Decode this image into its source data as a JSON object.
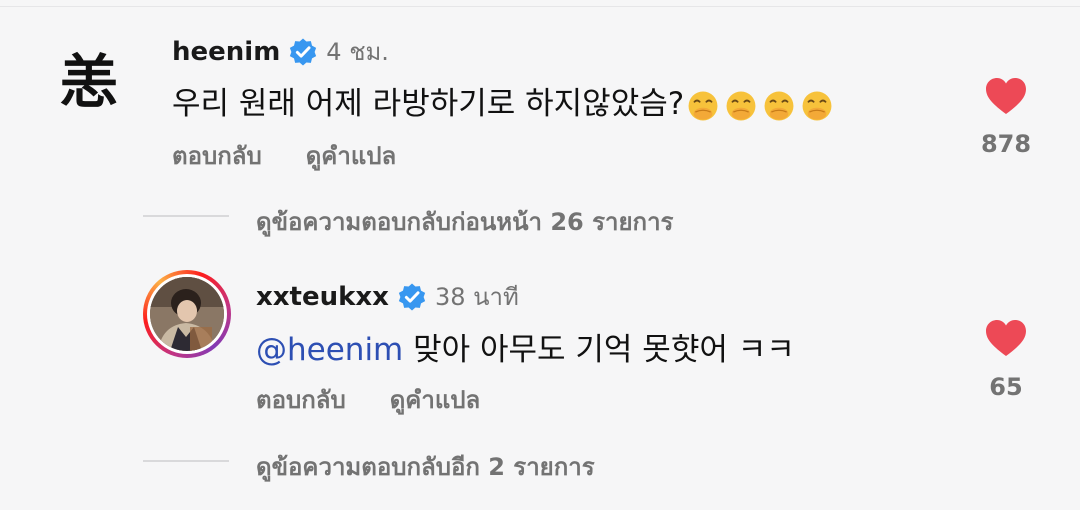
{
  "comment": {
    "username": "heenim",
    "verified": true,
    "timestamp": "4 ชม.",
    "text": "우리 원래 어제 라방하기로 하지않았슴?",
    "emoji_count": 4,
    "emoji_icon": "face-with-hand-over-mouth",
    "reply_label": "ตอบกลับ",
    "translate_label": "ดูคำแปล",
    "like_count": "878",
    "avatar_glyph": "恙"
  },
  "view_previous_replies": "ดูข้อความตอบกลับก่อนหน้า 26 รายการ",
  "reply": {
    "username": "xxteukxx",
    "verified": true,
    "timestamp": "38 นาที",
    "mention": "@heenim",
    "text": " 맞아 아무도 기억 못햣어 ㅋㅋ",
    "reply_label": "ตอบกลับ",
    "translate_label": "ดูคำแปล",
    "like_count": "65"
  },
  "view_more_replies": "ดูข้อความตอบกลับอีก 2 รายการ",
  "colors": {
    "heart": "#ed4956",
    "verified": "#3897f0",
    "mention": "#2d4fb3",
    "muted": "#737373"
  }
}
